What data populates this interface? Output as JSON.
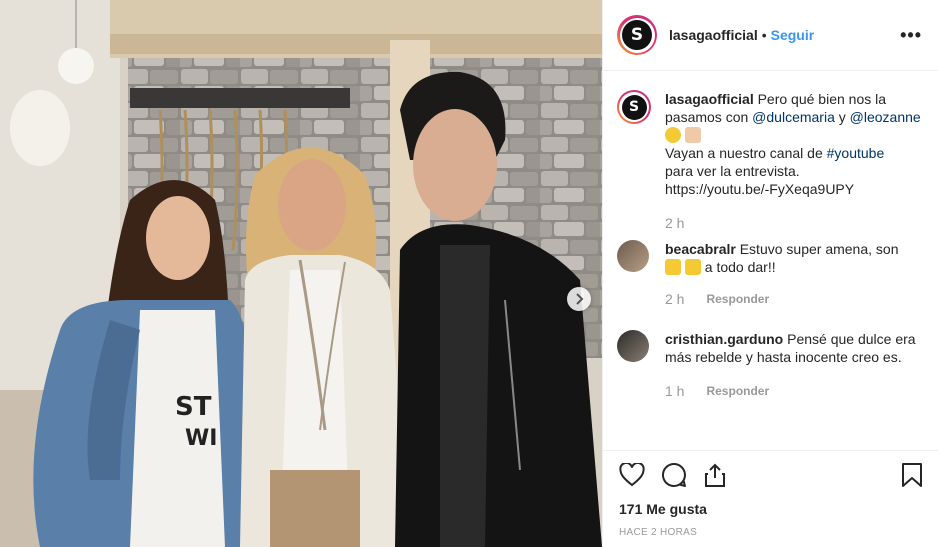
{
  "post": {
    "username": "lasagaofficial",
    "dot": "•",
    "follow_label": "Seguir",
    "more_label": "•••",
    "avatar_letter": "S"
  },
  "caption": {
    "username": "lasagaofficial",
    "text_1": "Pero qué bien nos la pasamos con ",
    "mention_1": "@dulcemaria",
    "text_2": " y ",
    "mention_2": "@leozanne",
    "text_3": "Vayan a nuestro canal de ",
    "hashtag": "#youtube",
    "text_4": "para ver la entrevista.",
    "url": "https://youtu.be/-FyXeqa9UPY",
    "time": "2 h"
  },
  "comments": [
    {
      "username": "beacabralr",
      "text_1": "Estuvo super amena, son",
      "text_2": "a todo dar!!",
      "time": "2 h",
      "reply_label": "Responder"
    },
    {
      "username": "cristhian.garduno",
      "text": "Pensé que dulce era más rebelde y hasta inocente creo es.",
      "time": "1 h",
      "reply_label": "Responder"
    }
  ],
  "footer": {
    "likes": "171 Me gusta",
    "posted": "HACE 2 HORAS"
  },
  "icons": {
    "like": "heart-icon",
    "comment": "comment-icon",
    "share": "share-icon",
    "save": "bookmark-icon",
    "next": "chevron-right-icon"
  },
  "colors": {
    "link": "#003569",
    "follow": "#3897f0",
    "muted": "#999999"
  }
}
